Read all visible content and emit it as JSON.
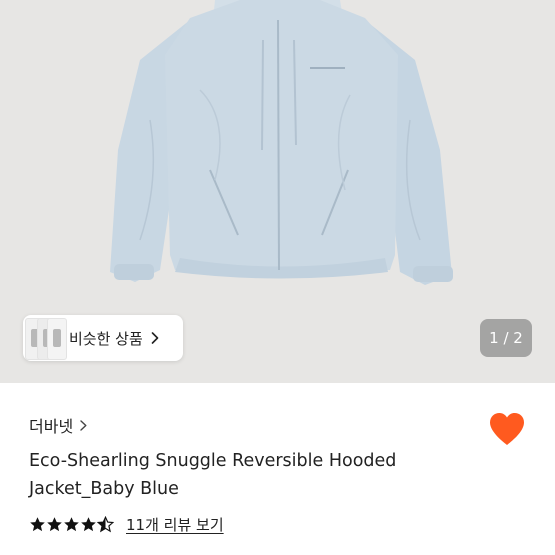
{
  "product_image": {
    "alt": "Eco-Shearling Snuggle Reversible Hooded Jacket_Baby Blue",
    "jacket_color": "#cbd9e4",
    "background_color": "#e7e6e4"
  },
  "similar_products": {
    "label": "비슷한 상품",
    "icon": "chevron-right-icon"
  },
  "image_pager": {
    "text": "1 / 2"
  },
  "brand": {
    "name": "더바넷",
    "icon": "chevron-right-icon"
  },
  "favorite": {
    "icon": "heart-icon",
    "color": "#ff5a1f",
    "active": true
  },
  "product": {
    "title": "Eco-Shearling Snuggle Reversible Hooded Jacket_Baby Blue"
  },
  "rating": {
    "stars": 4.5,
    "max": 5,
    "star_color": "#111111",
    "review_link": "11개 리뷰 보기"
  }
}
